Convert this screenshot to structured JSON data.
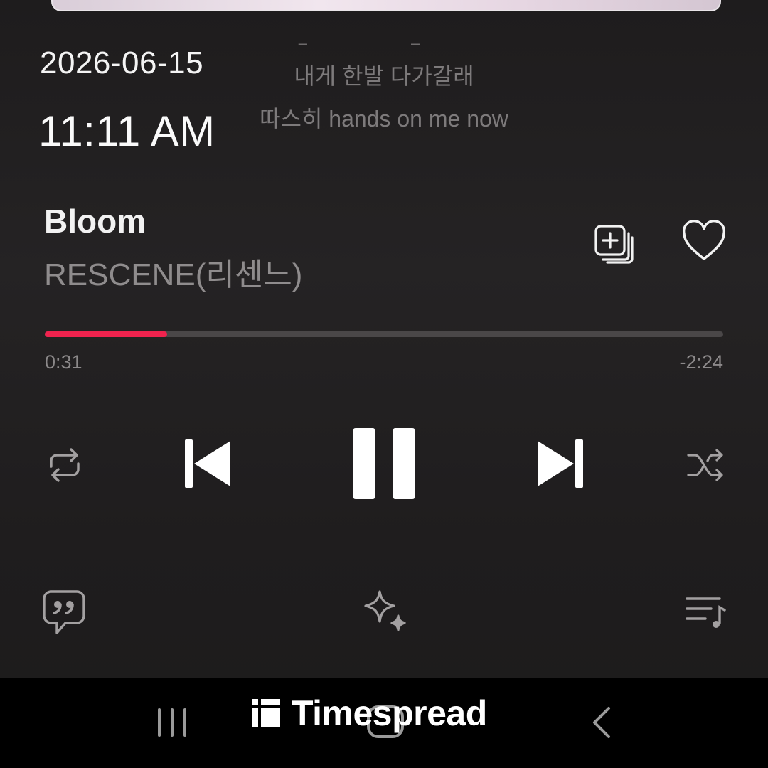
{
  "status": {
    "date": "2026-06-15",
    "time": "11:11 AM"
  },
  "lyrics": {
    "dashes": "– –",
    "line1": "내게 한발 다가갈래",
    "line2": "따스히 hands on me now"
  },
  "track": {
    "title": "Bloom",
    "artist": "RESCENE(리센느)"
  },
  "playback": {
    "elapsed": "0:31",
    "remaining": "-2:24",
    "progress": 0.18,
    "state": "playing"
  },
  "colors": {
    "accent": "#f0234e",
    "track": "#4a4748",
    "background": "#1f1d1e"
  },
  "icons": {
    "add_to_playlist": "add-to-playlist-icon",
    "like": "heart-icon",
    "repeat": "repeat-icon",
    "previous": "skip-previous-icon",
    "pause": "pause-icon",
    "next": "skip-next-icon",
    "shuffle": "shuffle-icon",
    "lyrics": "lyrics-quote-icon",
    "ai": "sparkle-icon",
    "queue": "queue-music-icon"
  },
  "navbar": {
    "recent": "recent-apps-icon",
    "home": "home-icon",
    "back": "back-icon"
  },
  "watermark": {
    "text": "Timespread"
  }
}
